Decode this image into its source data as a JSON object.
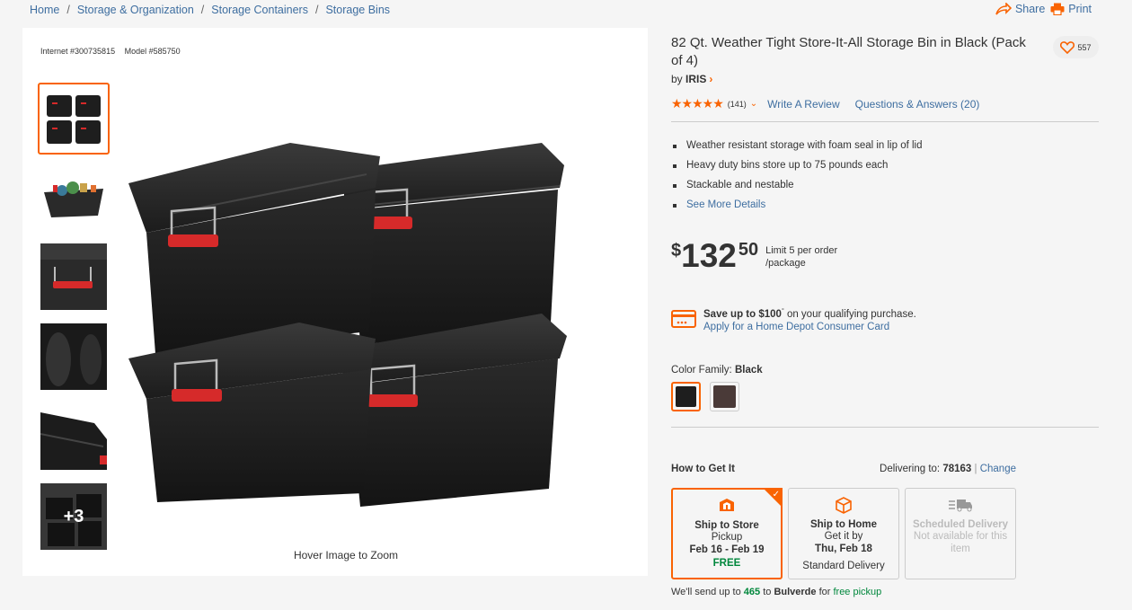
{
  "breadcrumb": [
    {
      "label": "Home"
    },
    {
      "label": "Storage & Organization"
    },
    {
      "label": "Storage Containers"
    },
    {
      "label": "Storage Bins"
    }
  ],
  "top_actions": {
    "share": "Share",
    "print": "Print"
  },
  "product": {
    "internet_id": "Internet #300735815",
    "model": "Model #585750",
    "title": "82 Qt. Weather Tight Store-It-All Storage Bin in Black (Pack of 4)",
    "by": "by",
    "brand": "IRIS",
    "favorites": "557",
    "rating": {
      "stars": "★★★★★",
      "count": "(141)",
      "write_review": "Write A Review",
      "qa": "Questions & Answers (20)"
    },
    "bullets": [
      "Weather resistant storage with foam seal in lip of lid",
      "Heavy duty bins store up to 75 pounds each",
      "Stackable and nestable"
    ],
    "see_more": "See More Details",
    "price": {
      "currency": "$",
      "dollars": "132",
      "cents": "50",
      "limit": "Limit 5 per order",
      "unit": "/package"
    },
    "credit": {
      "save": "Save up to $100",
      "sup": "°",
      "rest": " on your qualifying purchase.",
      "apply": "Apply for a Home Depot Consumer Card"
    },
    "color": {
      "label": "Color Family: ",
      "value": "Black",
      "swatches": [
        "#1e1e1e",
        "#4a3a38"
      ]
    }
  },
  "gallery": {
    "more": "+3",
    "zoom_hint": "Hover Image to Zoom"
  },
  "fulfillment": {
    "heading": "How to Get It",
    "delivering_to": "Delivering to: ",
    "zip": "78163",
    "sep": " | ",
    "change": "Change",
    "options": [
      {
        "name": "Ship to Store",
        "line1": "Pickup",
        "line2": "Feb 16 - Feb 19",
        "line3": "FREE"
      },
      {
        "name": "Ship to Home",
        "line1": "Get it by",
        "line2": "Thu, Feb 18",
        "line3": "Standard Delivery"
      },
      {
        "name": "Scheduled Delivery",
        "line1": "Not available for this",
        "line2": "item"
      }
    ],
    "send": {
      "a": "We'll send up to ",
      "qty": "465",
      "b": " to ",
      "store": "Bulverde",
      "c": " for ",
      "pickup": "free pickup"
    }
  },
  "colors": {
    "accent": "#f96302",
    "link": "#3e6ea0",
    "green": "#00873c"
  }
}
